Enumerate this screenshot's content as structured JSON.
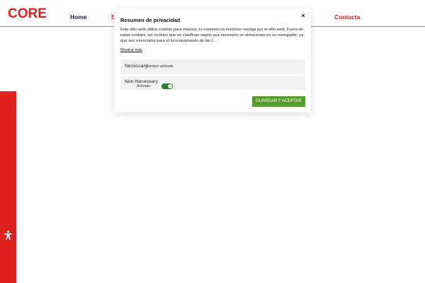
{
  "header": {
    "logo_text": "CORE",
    "nav": {
      "home": "Home",
      "partial": "S",
      "contact": "Contacta"
    }
  },
  "modal": {
    "title": "Resumen de privacidad",
    "close_label": "×",
    "description": "Este sitio web utiliza cookies para mejorar su experiencia mientras navega por el sitio web. Fuera de estas cookies, las cookies que se clasifican según sea necesario se almacenan en su navegador, ya que son esenciales para el funcionamiento de las f...",
    "show_more": "Mostrar más",
    "categories": [
      {
        "name": "Necessary",
        "status": "Siempre activado"
      },
      {
        "name": "Non-Necessary",
        "toggle_label": "Activado",
        "enabled": true
      }
    ],
    "save_button": "GUARDAR Y ACEPTAR"
  },
  "colors": {
    "brand_red": "#e0201c",
    "accept_green": "#5b9a2e",
    "toggle_green": "#2e7d32"
  },
  "icons": {
    "accessibility": "accessibility-icon",
    "close": "close-icon"
  }
}
